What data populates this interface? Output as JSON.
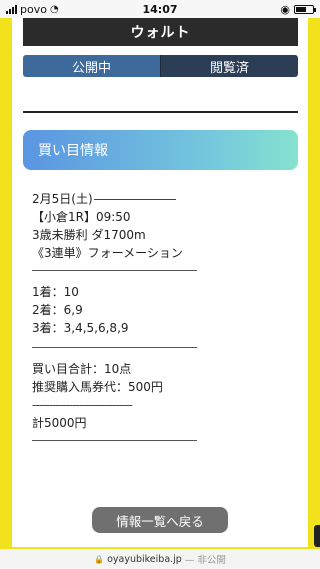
{
  "status_bar": {
    "carrier": "povo",
    "time": "14:07"
  },
  "page": {
    "title": "ウォルト",
    "tabs": [
      {
        "label": "公開中",
        "active": true
      },
      {
        "label": "閲覧済",
        "active": false
      }
    ],
    "section_title": "買い目情報",
    "race": {
      "date": "2月5日(土)",
      "race": "【小倉1R】09:50",
      "class": "3歳未勝利 ダ1700m",
      "bet_type": "《3連単》フォーメーション"
    },
    "positions": [
      "1着：10",
      "2着：6,9",
      "3着：3,4,5,6,8,9"
    ],
    "totals": {
      "points": "買い目合計：10点",
      "recommended": "推奨購入馬券代：500円",
      "separator": "------------------------------",
      "total": "計5000円"
    },
    "back_button": "情報一覧へ戻る"
  },
  "browser": {
    "url": "oyayubikeiba.jp",
    "suffix": "— 非公開"
  },
  "colors": {
    "background": "#f2e21c",
    "title_bar": "#2b2b2b",
    "tab_active": "#3d6a9b",
    "tab_inactive": "#2c3e55",
    "header_gradient_start": "#5a95e2",
    "header_gradient_end": "#86e2cf",
    "button": "#707070"
  }
}
